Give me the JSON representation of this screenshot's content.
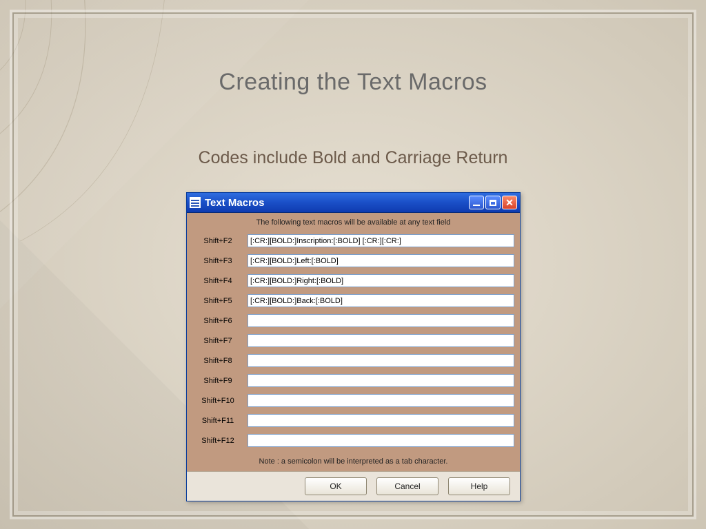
{
  "slide": {
    "title": "Creating the Text Macros",
    "subtitle": "Codes include Bold and Carriage Return"
  },
  "dialog": {
    "title": "Text Macros",
    "intro": "The following text macros will be available at any text field",
    "rows": [
      {
        "label": "Shift+F2",
        "value": "[:CR:][BOLD:]Inscription:[:BOLD] [:CR:][:CR:]"
      },
      {
        "label": "Shift+F3",
        "value": "[:CR:][BOLD:]Left:[:BOLD]"
      },
      {
        "label": "Shift+F4",
        "value": "[:CR:][BOLD:]Right:[:BOLD]"
      },
      {
        "label": "Shift+F5",
        "value": "[:CR:][BOLD:]Back:[:BOLD]"
      },
      {
        "label": "Shift+F6",
        "value": ""
      },
      {
        "label": "Shift+F7",
        "value": ""
      },
      {
        "label": "Shift+F8",
        "value": ""
      },
      {
        "label": "Shift+F9",
        "value": ""
      },
      {
        "label": "Shift+F10",
        "value": ""
      },
      {
        "label": "Shift+F11",
        "value": ""
      },
      {
        "label": "Shift+F12",
        "value": ""
      }
    ],
    "note": "Note :  a semicolon will be interpreted as a tab character.",
    "buttons": {
      "ok": "OK",
      "cancel": "Cancel",
      "help": "Help"
    }
  }
}
